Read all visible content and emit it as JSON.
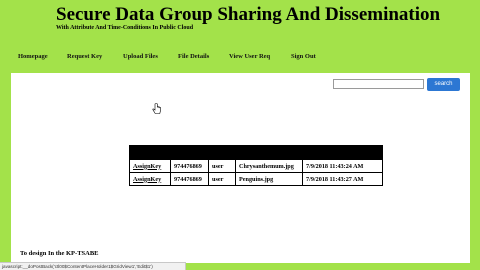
{
  "header": {
    "title": "Secure Data Group Sharing And Dissemination",
    "subtitle": "With Attribute And Time-Conditions In Public Cloud"
  },
  "nav": {
    "items": [
      {
        "label": "Homepage"
      },
      {
        "label": "Request Key"
      },
      {
        "label": "Upload Files"
      },
      {
        "label": "File Details"
      },
      {
        "label": "View User Req"
      },
      {
        "label": "Sign Out"
      }
    ]
  },
  "search": {
    "value": "",
    "button_label": "search"
  },
  "table": {
    "rows": [
      {
        "action": "AssignKey",
        "phone": "974476869",
        "role": "user",
        "file": "Chrysanthemum.jpg",
        "date": "7/9/2018 11:43:24 AM"
      },
      {
        "action": "AssignKey",
        "phone": "974476869",
        "role": "user",
        "file": "Penguins.jpg",
        "date": "7/9/2018 11:43:27 AM"
      }
    ]
  },
  "footer": {
    "text": "To design In the KP-TSABE"
  },
  "status_bar": {
    "text": "javascript:__doPostBack('ctl00$ContentPlaceHolder1$GridView1','Edit$1')"
  },
  "colors": {
    "page_background": "#a3e24a",
    "content_background": "#ffffff",
    "search_button": "#2c77d3",
    "table_header": "#000000"
  }
}
